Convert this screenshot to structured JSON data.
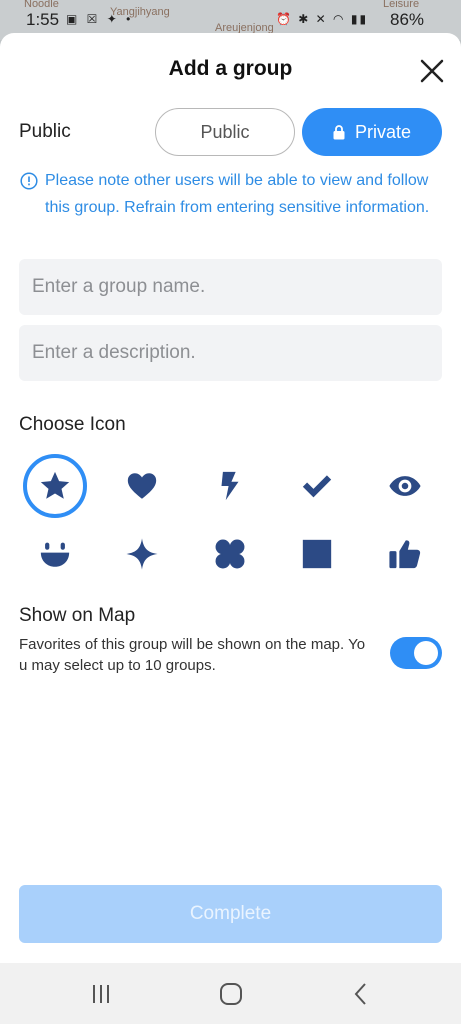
{
  "status_bar": {
    "time": "1:55",
    "battery": "86%",
    "map_labels": [
      "Noodle",
      "Yangjihyang",
      "Areujenjong",
      "Leisure"
    ]
  },
  "sheet": {
    "title": "Add a group"
  },
  "visibility": {
    "label": "Public",
    "options": [
      "Public",
      "Private"
    ],
    "selected": "Private"
  },
  "notice": {
    "text": "Please note other users will be able to view and follow this group. Refrain from entering sensitive information."
  },
  "form": {
    "name_placeholder": "Enter a group name.",
    "name_value": "",
    "description_placeholder": "Enter a description.",
    "description_value": ""
  },
  "icons": {
    "label": "Choose Icon",
    "items": [
      "star-icon",
      "heart-icon",
      "lightning-icon",
      "checkmark-icon",
      "eye-icon",
      "smile-icon",
      "sparkle-icon",
      "clover-icon",
      "square-icon",
      "thumbs-up-icon"
    ],
    "selected": "star-icon"
  },
  "show_on_map": {
    "title": "Show on Map",
    "description": "Favorites of this group will be shown on the map. You may select up to 10 groups.",
    "enabled": true
  },
  "complete": {
    "label": "Complete",
    "enabled": false
  },
  "colors": {
    "accent": "#2f8ef5",
    "icon": "#2c4a85",
    "notice": "#2e8ce4",
    "complete_disabled": "#a9d0fb"
  }
}
